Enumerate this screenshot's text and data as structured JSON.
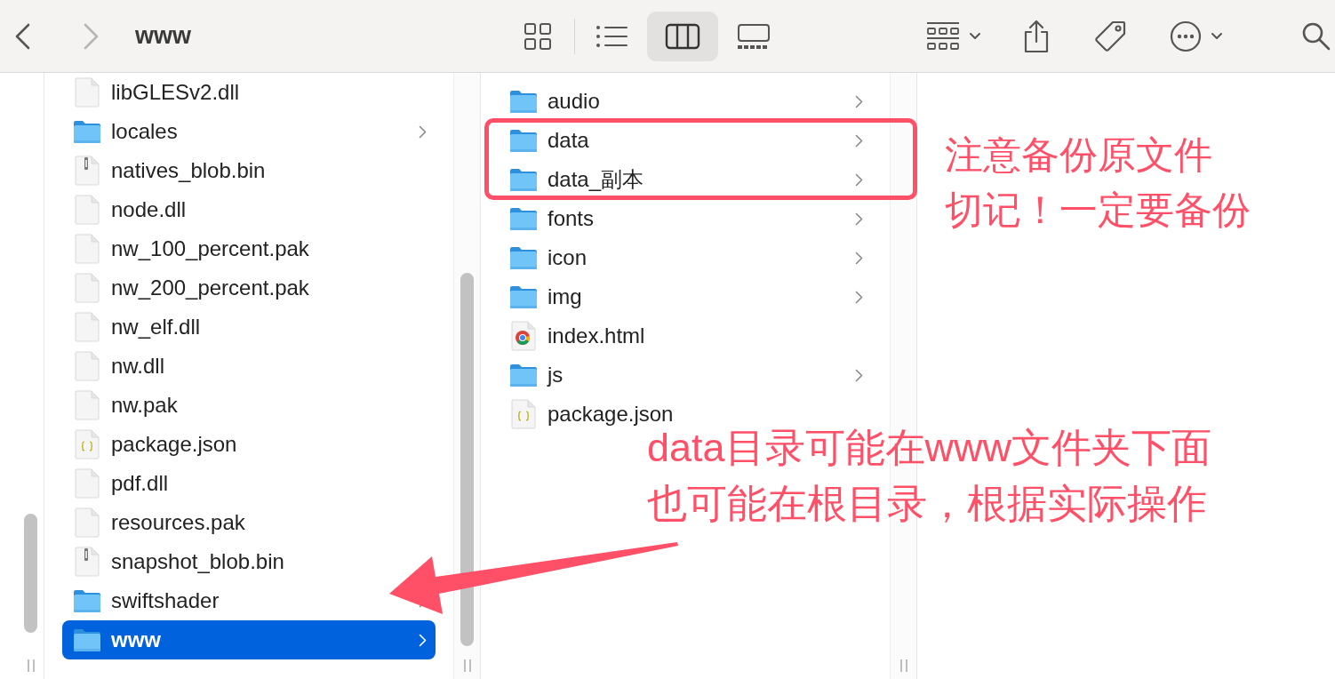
{
  "toolbar": {
    "back": {
      "disabled": false
    },
    "forward": {
      "disabled": true
    },
    "title": "www",
    "view_buttons": [
      {
        "kind": "icons",
        "selected": false
      },
      {
        "kind": "list",
        "selected": false
      },
      {
        "kind": "columns",
        "selected": true
      },
      {
        "kind": "gallery",
        "selected": false
      }
    ]
  },
  "columns": [
    {
      "items": [
        {
          "name": "libGLESv2.dll",
          "kind": "document",
          "selected": false
        },
        {
          "name": "locales",
          "kind": "folder",
          "selected": false
        },
        {
          "name": "natives_blob.bin",
          "kind": "archive",
          "selected": false
        },
        {
          "name": "node.dll",
          "kind": "document",
          "selected": false
        },
        {
          "name": "nw_100_percent.pak",
          "kind": "document",
          "selected": false
        },
        {
          "name": "nw_200_percent.pak",
          "kind": "document",
          "selected": false
        },
        {
          "name": "nw_elf.dll",
          "kind": "document",
          "selected": false
        },
        {
          "name": "nw.dll",
          "kind": "document",
          "selected": false
        },
        {
          "name": "nw.pak",
          "kind": "document",
          "selected": false
        },
        {
          "name": "package.json",
          "kind": "json",
          "selected": false
        },
        {
          "name": "pdf.dll",
          "kind": "document",
          "selected": false
        },
        {
          "name": "resources.pak",
          "kind": "document",
          "selected": false
        },
        {
          "name": "snapshot_blob.bin",
          "kind": "archive",
          "selected": false
        },
        {
          "name": "swiftshader",
          "kind": "folder",
          "selected": false
        },
        {
          "name": "www",
          "kind": "folder",
          "selected": true
        }
      ]
    },
    {
      "items": [
        {
          "name": "audio",
          "kind": "folder",
          "selected": false
        },
        {
          "name": "data",
          "kind": "folder",
          "selected": false
        },
        {
          "name": "data_副本",
          "kind": "folder",
          "selected": false
        },
        {
          "name": "fonts",
          "kind": "folder",
          "selected": false
        },
        {
          "name": "icon",
          "kind": "folder",
          "selected": false
        },
        {
          "name": "img",
          "kind": "folder",
          "selected": false
        },
        {
          "name": "index.html",
          "kind": "webpage",
          "selected": false
        },
        {
          "name": "js",
          "kind": "folder",
          "selected": false
        },
        {
          "name": "package.json",
          "kind": "json",
          "selected": false
        }
      ]
    }
  ],
  "annotations": [
    {
      "lines": [
        "注意备份原文件",
        "切记！一定要备份"
      ]
    },
    {
      "lines": [
        "data目录可能在www文件夹下面",
        "也可能在根目录，根据实际操作"
      ]
    }
  ]
}
